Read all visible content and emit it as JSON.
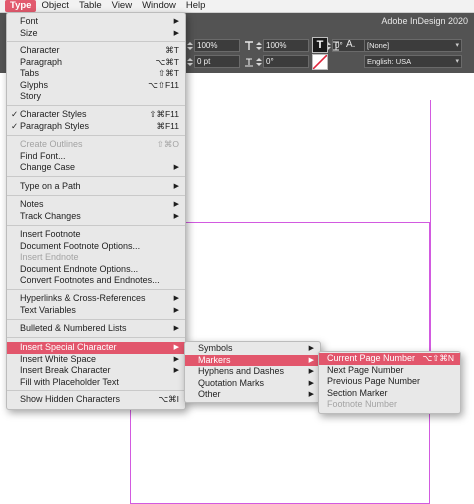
{
  "menubar": {
    "items": [
      "Type",
      "Object",
      "Table",
      "View",
      "Window",
      "Help"
    ]
  },
  "app_title": "Adobe InDesign 2020",
  "control_bar": {
    "row1": {
      "scale_v": "100%",
      "scale_h": "100%",
      "skew_value": "0°"
    },
    "row2": {
      "baseline_shift": "0 pt",
      "skew_angle": "0°"
    },
    "character_style": "[None]",
    "language": "English: USA",
    "icons": [
      "text-cursor-icon",
      "baseline-shift-icon",
      "skew-icon",
      "fill-stroke-icon",
      "none-swatch-icon",
      "char-style-icon"
    ]
  },
  "type_menu": {
    "font": "Font",
    "size": "Size",
    "character": "Character",
    "character_sc": "⌘T",
    "paragraph": "Paragraph",
    "paragraph_sc": "⌥⌘T",
    "tabs": "Tabs",
    "tabs_sc": "⇧⌘T",
    "glyphs": "Glyphs",
    "glyphs_sc": "⌥⇧F11",
    "story": "Story",
    "character_styles": "Character Styles",
    "character_styles_sc": "⇧⌘F11",
    "paragraph_styles": "Paragraph Styles",
    "paragraph_styles_sc": "⌘F11",
    "create_outlines": "Create Outlines",
    "create_outlines_sc": "⇧⌘O",
    "find_font": "Find Font...",
    "change_case": "Change Case",
    "type_on_path": "Type on a Path",
    "notes": "Notes",
    "track_changes": "Track Changes",
    "insert_footnote": "Insert Footnote",
    "document_footnote_options": "Document Footnote Options...",
    "insert_endnote": "Insert Endnote",
    "document_endnote_options": "Document Endnote Options...",
    "convert_footnotes": "Convert Footnotes and Endnotes...",
    "hyperlinks": "Hyperlinks & Cross-References",
    "text_variables": "Text Variables",
    "bulleted_numbered": "Bulleted & Numbered Lists",
    "insert_special": "Insert Special Character",
    "insert_white_space": "Insert White Space",
    "insert_break": "Insert Break Character",
    "fill_placeholder": "Fill with Placeholder Text",
    "show_hidden": "Show Hidden Characters",
    "show_hidden_sc": "⌥⌘I"
  },
  "special_menu": {
    "symbols": "Symbols",
    "markers": "Markers",
    "hyphens_dashes": "Hyphens and Dashes",
    "quotation_marks": "Quotation Marks",
    "other": "Other"
  },
  "markers_menu": {
    "current_page": "Current Page Number",
    "current_page_sc": "⌥⇧⌘N",
    "next_page": "Next Page Number",
    "previous_page": "Previous Page Number",
    "section_marker": "Section Marker",
    "footnote_number": "Footnote Number"
  },
  "colors": {
    "menu_highlight": "#e2566c",
    "menubar_active": "#e25a6e",
    "control_bar_bg": "#535353",
    "guide_magenta": "#d25ae0"
  }
}
